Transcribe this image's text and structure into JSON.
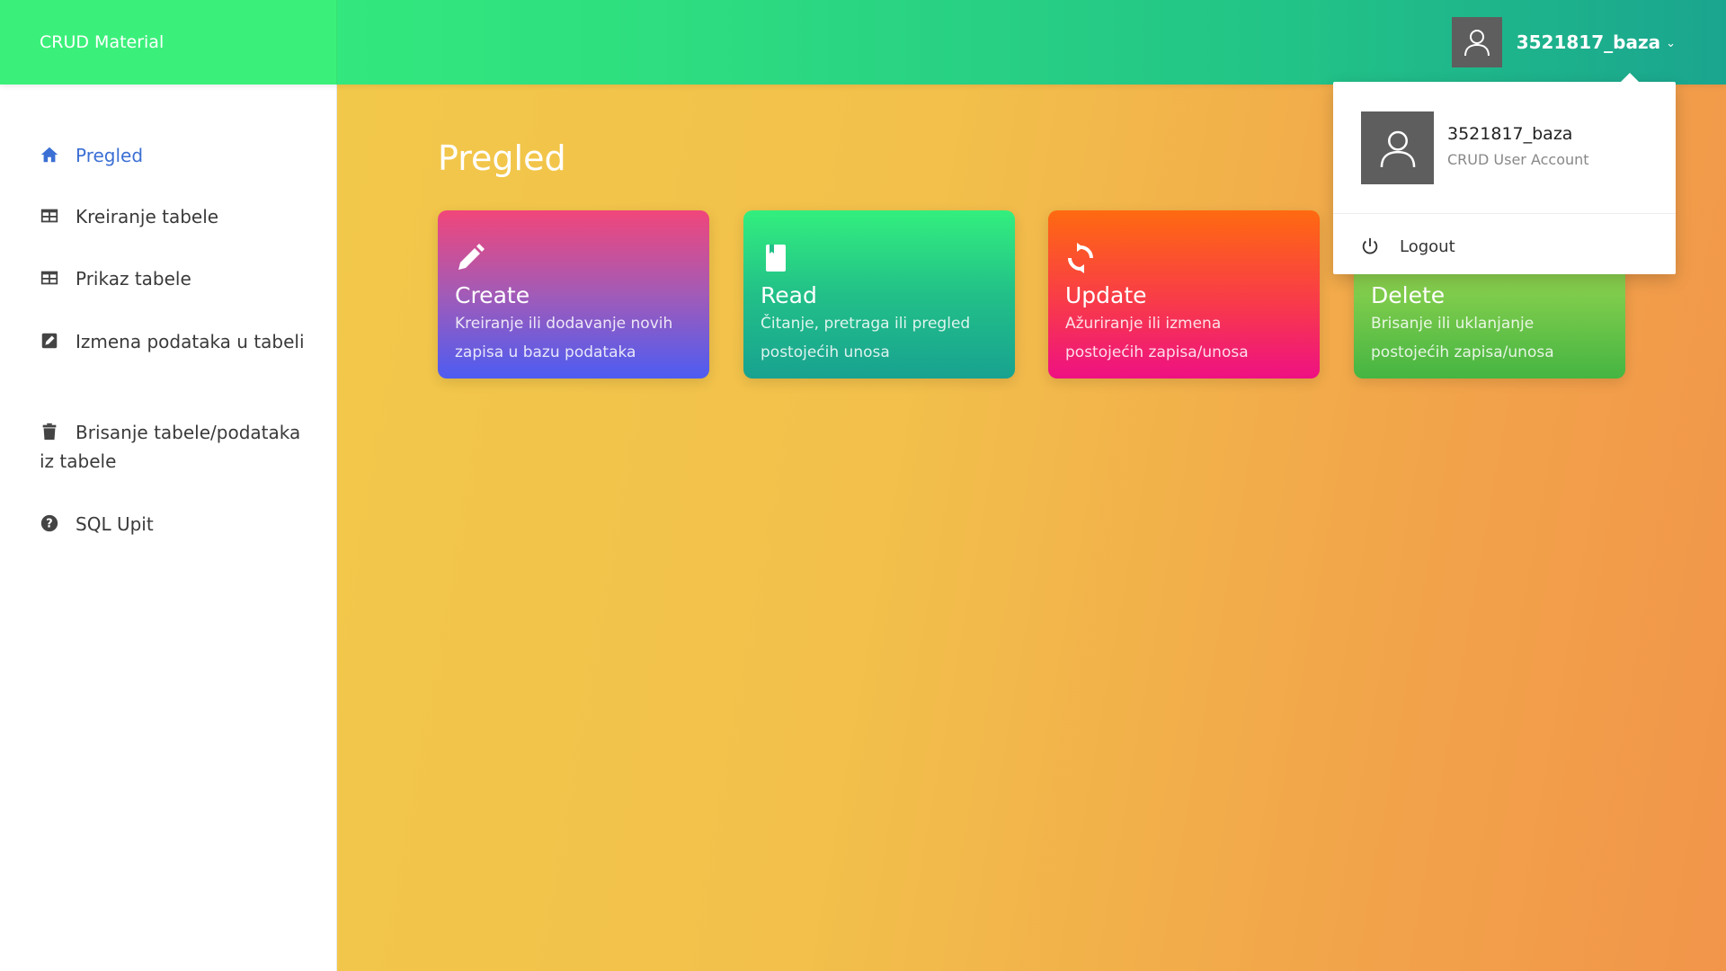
{
  "app": {
    "brand": "CRUD Material"
  },
  "user": {
    "name": "3521817_baza",
    "role": "CRUD User Account",
    "logout_label": "Logout"
  },
  "sidebar": {
    "items": [
      {
        "label": "Pregled",
        "icon": "home-icon",
        "active": true
      },
      {
        "label": "Kreiranje tabele",
        "icon": "table-icon"
      },
      {
        "label": "Prikaz tabele",
        "icon": "table-icon"
      },
      {
        "label": "Izmena podataka u tabeli",
        "icon": "edit-icon"
      },
      {
        "label": "Brisanje tabele/podataka iz tabele",
        "icon": "trash-icon"
      },
      {
        "label": "SQL Upit",
        "icon": "question-icon"
      }
    ]
  },
  "main": {
    "title": "Pregled",
    "cards": [
      {
        "title": "Create",
        "desc": "Kreiranje ili dodavanje novih zapisa u bazu podataka",
        "icon": "pencil-icon"
      },
      {
        "title": "Read",
        "desc": "Čitanje, pretraga ili pregled postojećih unosa",
        "icon": "book-icon"
      },
      {
        "title": "Update",
        "desc": "Ažuriranje ili izmena postojećih zapisa/unosa",
        "icon": "refresh-icon"
      },
      {
        "title": "Delete",
        "desc": "Brisanje ili uklanjanje postojećih zapisa/unosa",
        "icon": "trash-icon"
      }
    ]
  },
  "colors": {
    "accent": "#3b6fd4",
    "topbar_left": "#3bf07a",
    "topbar_right": "#1aa58f"
  }
}
